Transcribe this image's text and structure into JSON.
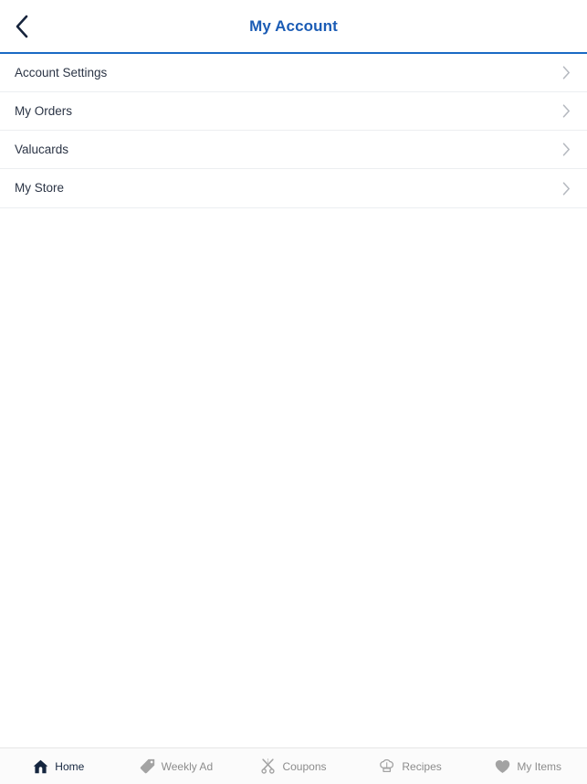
{
  "header": {
    "title": "My Account",
    "back_icon": "chevron-left-icon",
    "title_color": "#1b5cb5",
    "underline_color": "#1a6ac4",
    "back_icon_color": "#16243c"
  },
  "menu": {
    "chevron_icon": "chevron-right-icon",
    "chevron_color": "#b4b8bf",
    "items": [
      {
        "label": "Account Settings",
        "name": "account-settings"
      },
      {
        "label": "My Orders",
        "name": "my-orders"
      },
      {
        "label": "Valucards",
        "name": "valucards"
      },
      {
        "label": "My Store",
        "name": "my-store"
      }
    ]
  },
  "tabbar": {
    "active_color": "#15263f",
    "inactive_color": "#8c8c8c",
    "background": "#fbfbfb",
    "tabs": [
      {
        "label": "Home",
        "icon": "home-icon",
        "active": true
      },
      {
        "label": "Weekly Ad",
        "icon": "tag-icon",
        "active": false
      },
      {
        "label": "Coupons",
        "icon": "scissors-icon",
        "active": false
      },
      {
        "label": "Recipes",
        "icon": "chef-hat-icon",
        "active": false
      },
      {
        "label": "My Items",
        "icon": "heart-icon",
        "active": false
      }
    ]
  }
}
